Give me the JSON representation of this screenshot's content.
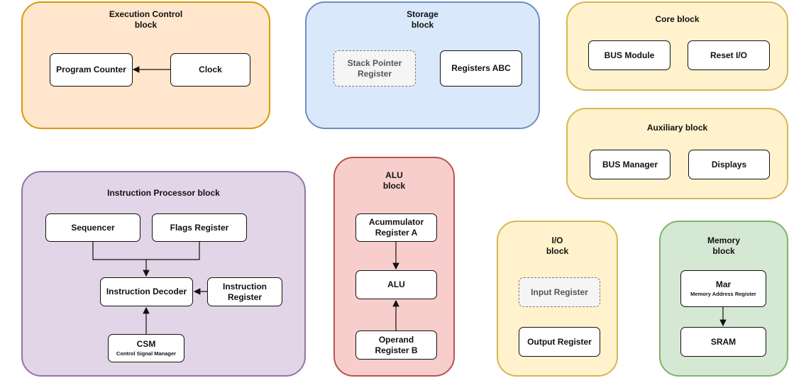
{
  "colors": {
    "orange_fill": "#ffe6cc",
    "orange_stroke": "#d79b00",
    "blue_fill": "#dae8fc",
    "blue_stroke": "#6c8ebf",
    "yellow_fill": "#fff2cc",
    "yellow_stroke": "#d6b656",
    "purple_fill": "#e1d5e7",
    "purple_stroke": "#9673a6",
    "red_fill": "#f8cecc",
    "red_stroke": "#b85450",
    "green_fill": "#d5e8d4",
    "green_stroke": "#82b366"
  },
  "execution": {
    "title": "Execution Control\nblock",
    "program_counter": "Program Counter",
    "clock": "Clock"
  },
  "storage": {
    "title": "Storage\nblock",
    "stack_pointer": "Stack Pointer\nRegister",
    "registers_abc": "Registers ABC"
  },
  "core": {
    "title": "Core  block",
    "bus_module": "BUS Module",
    "reset_io": "Reset I/O"
  },
  "auxiliary": {
    "title": "Auxiliary block",
    "bus_manager": "BUS Manager",
    "displays": "Displays"
  },
  "instruction": {
    "title": "Instruction Processor block",
    "sequencer": "Sequencer",
    "flags": "Flags Register",
    "decoder": "Instruction Decoder",
    "ir": "Instruction\nRegister",
    "csm": "CSM",
    "csm_sub": "Control Signal Manager"
  },
  "alu": {
    "title": "ALU\nblock",
    "acc": "Acummulator\nRegister A",
    "alu": "ALU",
    "operand": "Operand\nRegister B"
  },
  "io": {
    "title": "I/O\nblock",
    "input": "Input Register",
    "output": "Output Register"
  },
  "memory": {
    "title": "Memory\nblock",
    "mar": "Mar",
    "mar_sub": "Memory Address Register",
    "sram": "SRAM"
  }
}
